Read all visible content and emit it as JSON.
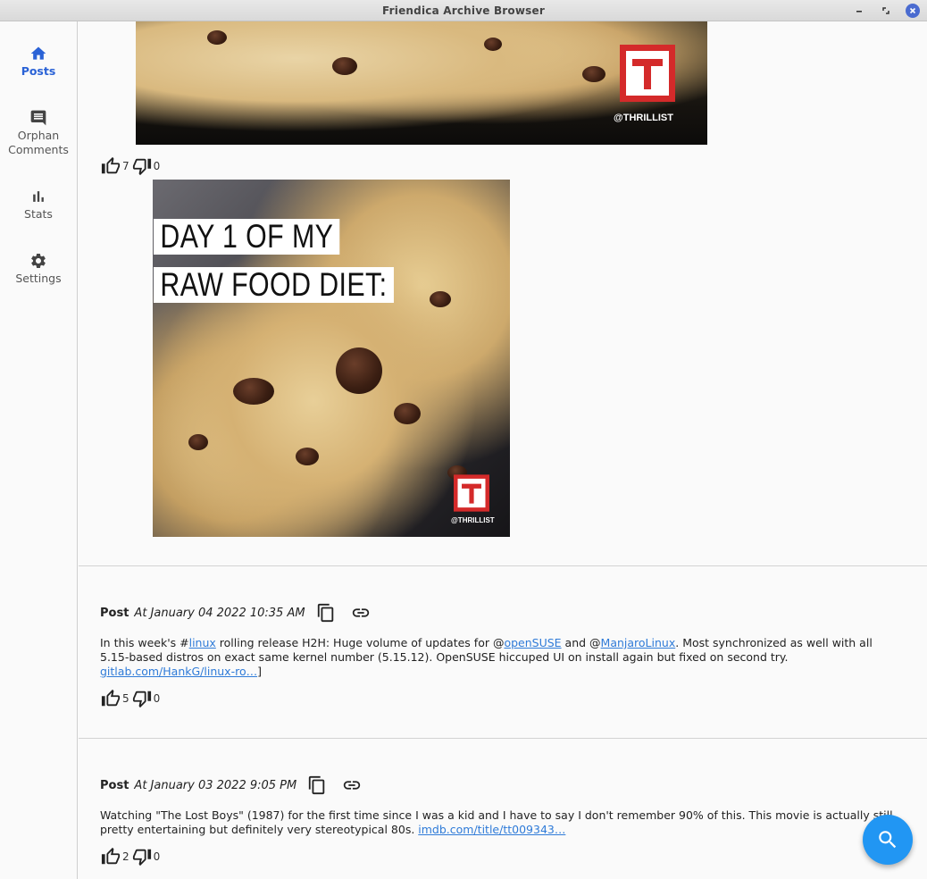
{
  "window": {
    "title": "Friendica Archive Browser"
  },
  "sidebar": {
    "items": [
      {
        "label": "Posts",
        "icon": "home-icon",
        "active": true
      },
      {
        "label": "Orphan\nComments",
        "icon": "comment-icon",
        "active": false
      },
      {
        "label": "Stats",
        "icon": "bar-chart-icon",
        "active": false
      },
      {
        "label": "Settings",
        "icon": "gear-icon",
        "active": false
      }
    ]
  },
  "media": {
    "top_image_brand": "@THRILLIST",
    "main_image_caption_line1": "DAY 1 OF MY",
    "main_image_caption_line2": "RAW FOOD DIET:",
    "main_image_brand": "@THRILLIST"
  },
  "first_reactions": {
    "likes": "7",
    "dislikes": "0"
  },
  "posts": [
    {
      "kind": "Post",
      "timestamp": "At January 04 2022 10:35 AM",
      "body": {
        "t1": "In this week's #",
        "link1": "linux",
        "t2": " rolling release H2H: Huge volume of updates for @",
        "link2": "openSUSE",
        "t3": " and @",
        "link3": "ManjaroLinux",
        "t4": ". Most synchronized as well with all 5.15-based distros on exact same kernel number (5.15.12). OpenSUSE hiccuped UI on install again but fixed on second try. ",
        "link4": "gitlab.com/HankG/linux-ro…",
        "t5": "]"
      },
      "likes": "5",
      "dislikes": "0"
    },
    {
      "kind": "Post",
      "timestamp": "At January 03 2022 9:05 PM",
      "body": {
        "t1": "Watching \"The Lost Boys\" (1987) for the first time since I was a kid and I have to say I don't remember 90% of this. This movie is actually still pretty entertaining but definitely very stereotypical 80s. ",
        "link1": "imdb.com/title/tt009343…"
      },
      "likes": "2",
      "dislikes": "0"
    }
  ],
  "colors": {
    "accent": "#2a62d6",
    "link": "#2f7bd8",
    "fab": "#2196f3",
    "brand_red": "#d42a2a"
  }
}
